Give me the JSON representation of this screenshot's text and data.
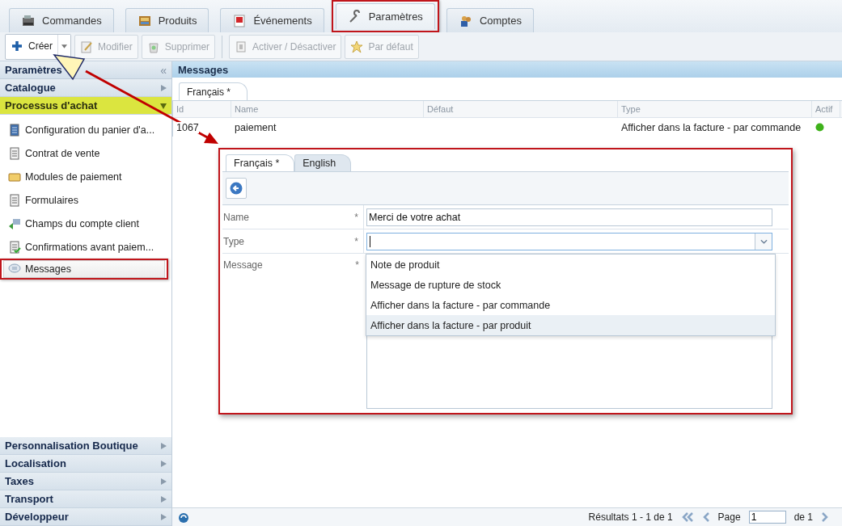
{
  "tabs": [
    {
      "label": "Commandes",
      "selected": false,
      "annotated": false
    },
    {
      "label": "Produits",
      "selected": false,
      "annotated": false
    },
    {
      "label": "Événements",
      "selected": false,
      "annotated": false
    },
    {
      "label": "Paramètres",
      "selected": true,
      "annotated": true
    },
    {
      "label": "Comptes",
      "selected": false,
      "annotated": false
    }
  ],
  "toolbar": [
    {
      "kind": "split",
      "label": "Créer",
      "disabled": false
    },
    {
      "kind": "button",
      "label": "Modifier",
      "disabled": true
    },
    {
      "kind": "button",
      "label": "Supprimer",
      "disabled": true
    },
    {
      "kind": "separator"
    },
    {
      "kind": "button",
      "label": "Activer / Désactiver",
      "disabled": true
    },
    {
      "kind": "button",
      "label": "Par défaut",
      "disabled": true
    }
  ],
  "sidebar": {
    "title": "Paramètres",
    "collapse": "«",
    "sections": [
      {
        "label": "Catalogue",
        "expanded": false
      },
      {
        "label": "Processus d'achat",
        "expanded": true,
        "children": [
          {
            "label": "Configuration du panier d'a...",
            "selected": false,
            "annotated": false
          },
          {
            "label": "Contrat de vente",
            "selected": false,
            "annotated": false
          },
          {
            "label": "Modules de paiement",
            "selected": false,
            "annotated": false
          },
          {
            "label": "Formulaires",
            "selected": false,
            "annotated": false
          },
          {
            "label": "Champs du compte client",
            "selected": false,
            "annotated": false
          },
          {
            "label": "Confirmations avant paiem...",
            "selected": false,
            "annotated": false
          },
          {
            "label": "Messages",
            "selected": true,
            "annotated": true
          }
        ]
      },
      {
        "label": "Personnalisation Boutique",
        "expanded": false
      },
      {
        "label": "Localisation",
        "expanded": false
      },
      {
        "label": "Taxes",
        "expanded": false
      },
      {
        "label": "Transport",
        "expanded": false
      },
      {
        "label": "Développeur",
        "expanded": false
      }
    ]
  },
  "panel": {
    "title": "Messages",
    "tabs": [
      {
        "label": "Français *",
        "selected": true
      }
    ],
    "grid": {
      "columns": [
        "Id",
        "Name",
        "Défaut",
        "Type",
        "Actif"
      ],
      "rows": [
        {
          "cells": [
            "1067",
            "paiement",
            "",
            "Afficher dans la facture - par commande"
          ],
          "active": true
        }
      ]
    },
    "pager": {
      "summary": "Résultats 1 - 1 de 1",
      "page_label": "Page",
      "page": "1",
      "total": "de 1"
    }
  },
  "editor": {
    "tabs": [
      {
        "label": "Français *",
        "selected": true
      },
      {
        "label": "English",
        "selected": false
      }
    ],
    "fields": [
      {
        "kind": "text",
        "label": "Name",
        "required_mark": "*",
        "value": "Merci de votre achat"
      },
      {
        "kind": "combo",
        "label": "Type",
        "required_mark": "*",
        "focused": true
      },
      {
        "kind": "textarea",
        "label": "Message",
        "required_mark": "*"
      }
    ],
    "dropdown": [
      {
        "label": "Note de produit",
        "selected": false
      },
      {
        "label": "Message de rupture de stock",
        "selected": false
      },
      {
        "label": "Afficher dans la facture - par commande",
        "selected": false
      },
      {
        "label": "Afficher dans la facture - par produit",
        "selected": true
      }
    ]
  }
}
